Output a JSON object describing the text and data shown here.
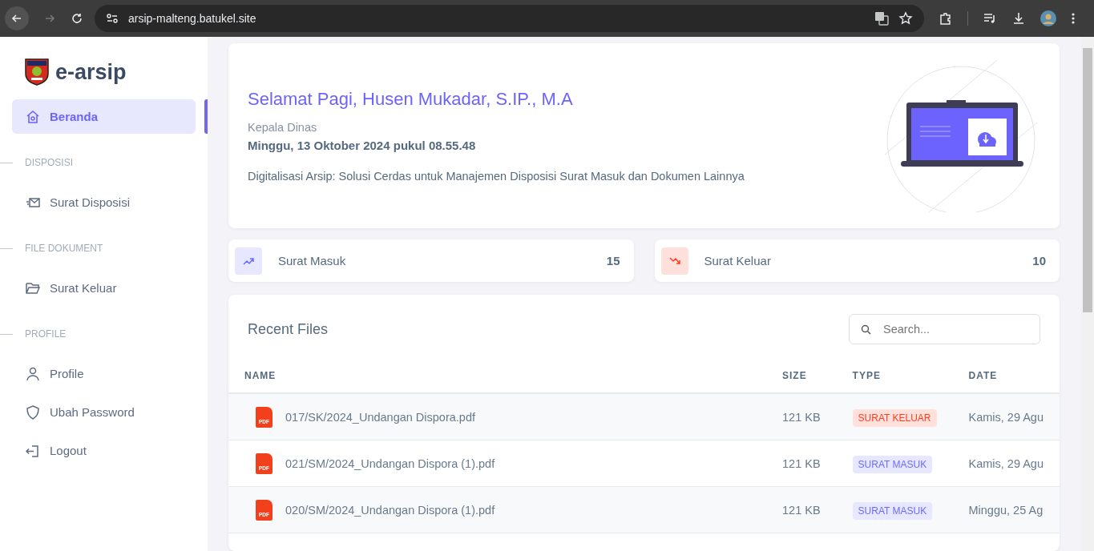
{
  "browser": {
    "url": "arsip-malteng.batukel.site"
  },
  "sidebar": {
    "brand": "e-arsip",
    "items": [
      {
        "kind": "link",
        "label": "Beranda",
        "selected": true
      },
      {
        "kind": "header",
        "label": "DISPOSISI"
      },
      {
        "kind": "link",
        "label": "Surat Disposisi",
        "selected": false
      },
      {
        "kind": "header",
        "label": "FILE DOKUMENT"
      },
      {
        "kind": "link",
        "label": "Surat Keluar",
        "selected": false
      },
      {
        "kind": "header",
        "label": "PROFILE"
      },
      {
        "kind": "link",
        "label": "Profile",
        "selected": false
      },
      {
        "kind": "link",
        "label": "Ubah Password",
        "selected": false
      },
      {
        "kind": "link",
        "label": "Logout",
        "selected": false
      }
    ]
  },
  "welcome": {
    "greeting": "Selamat Pagi, Husen Mukadar, S.IP., M.A",
    "role": "Kepala Dinas",
    "datetime": "Minggu, 13 Oktober 2024 pukul 08.55.48",
    "tagline": "Digitalisasi Arsip: Solusi Cerdas untuk Manajemen Disposisi Surat Masuk dan Dokumen Lainnya"
  },
  "stats": [
    {
      "kind": "up",
      "label": "Surat Masuk",
      "count": "15"
    },
    {
      "kind": "down",
      "label": "Surat Keluar",
      "count": "10"
    }
  ],
  "recent_files": {
    "title": "Recent Files",
    "search": {
      "placeholder": "Search..."
    },
    "columns": [
      "NAME",
      "SIZE",
      "TYPE",
      "DATE"
    ],
    "rows": [
      {
        "icon_label": "PDF",
        "name": "017/SK/2024_Undangan Dispora.pdf",
        "size": "121 KB",
        "type": {
          "kind": "keluar",
          "label": "SURAT KELUAR"
        },
        "date": "Kamis, 29 Agu"
      },
      {
        "icon_label": "PDF",
        "name": "021/SM/2024_Undangan Dispora (1).pdf",
        "size": "121 KB",
        "type": {
          "kind": "masuk",
          "label": "SURAT MASUK"
        },
        "date": "Kamis, 29 Agu"
      },
      {
        "icon_label": "PDF",
        "name": "020/SM/2024_Undangan Dispora (1).pdf",
        "size": "121 KB",
        "type": {
          "kind": "masuk",
          "label": "SURAT MASUK"
        },
        "date": "Minggu, 25 Ag"
      }
    ]
  }
}
